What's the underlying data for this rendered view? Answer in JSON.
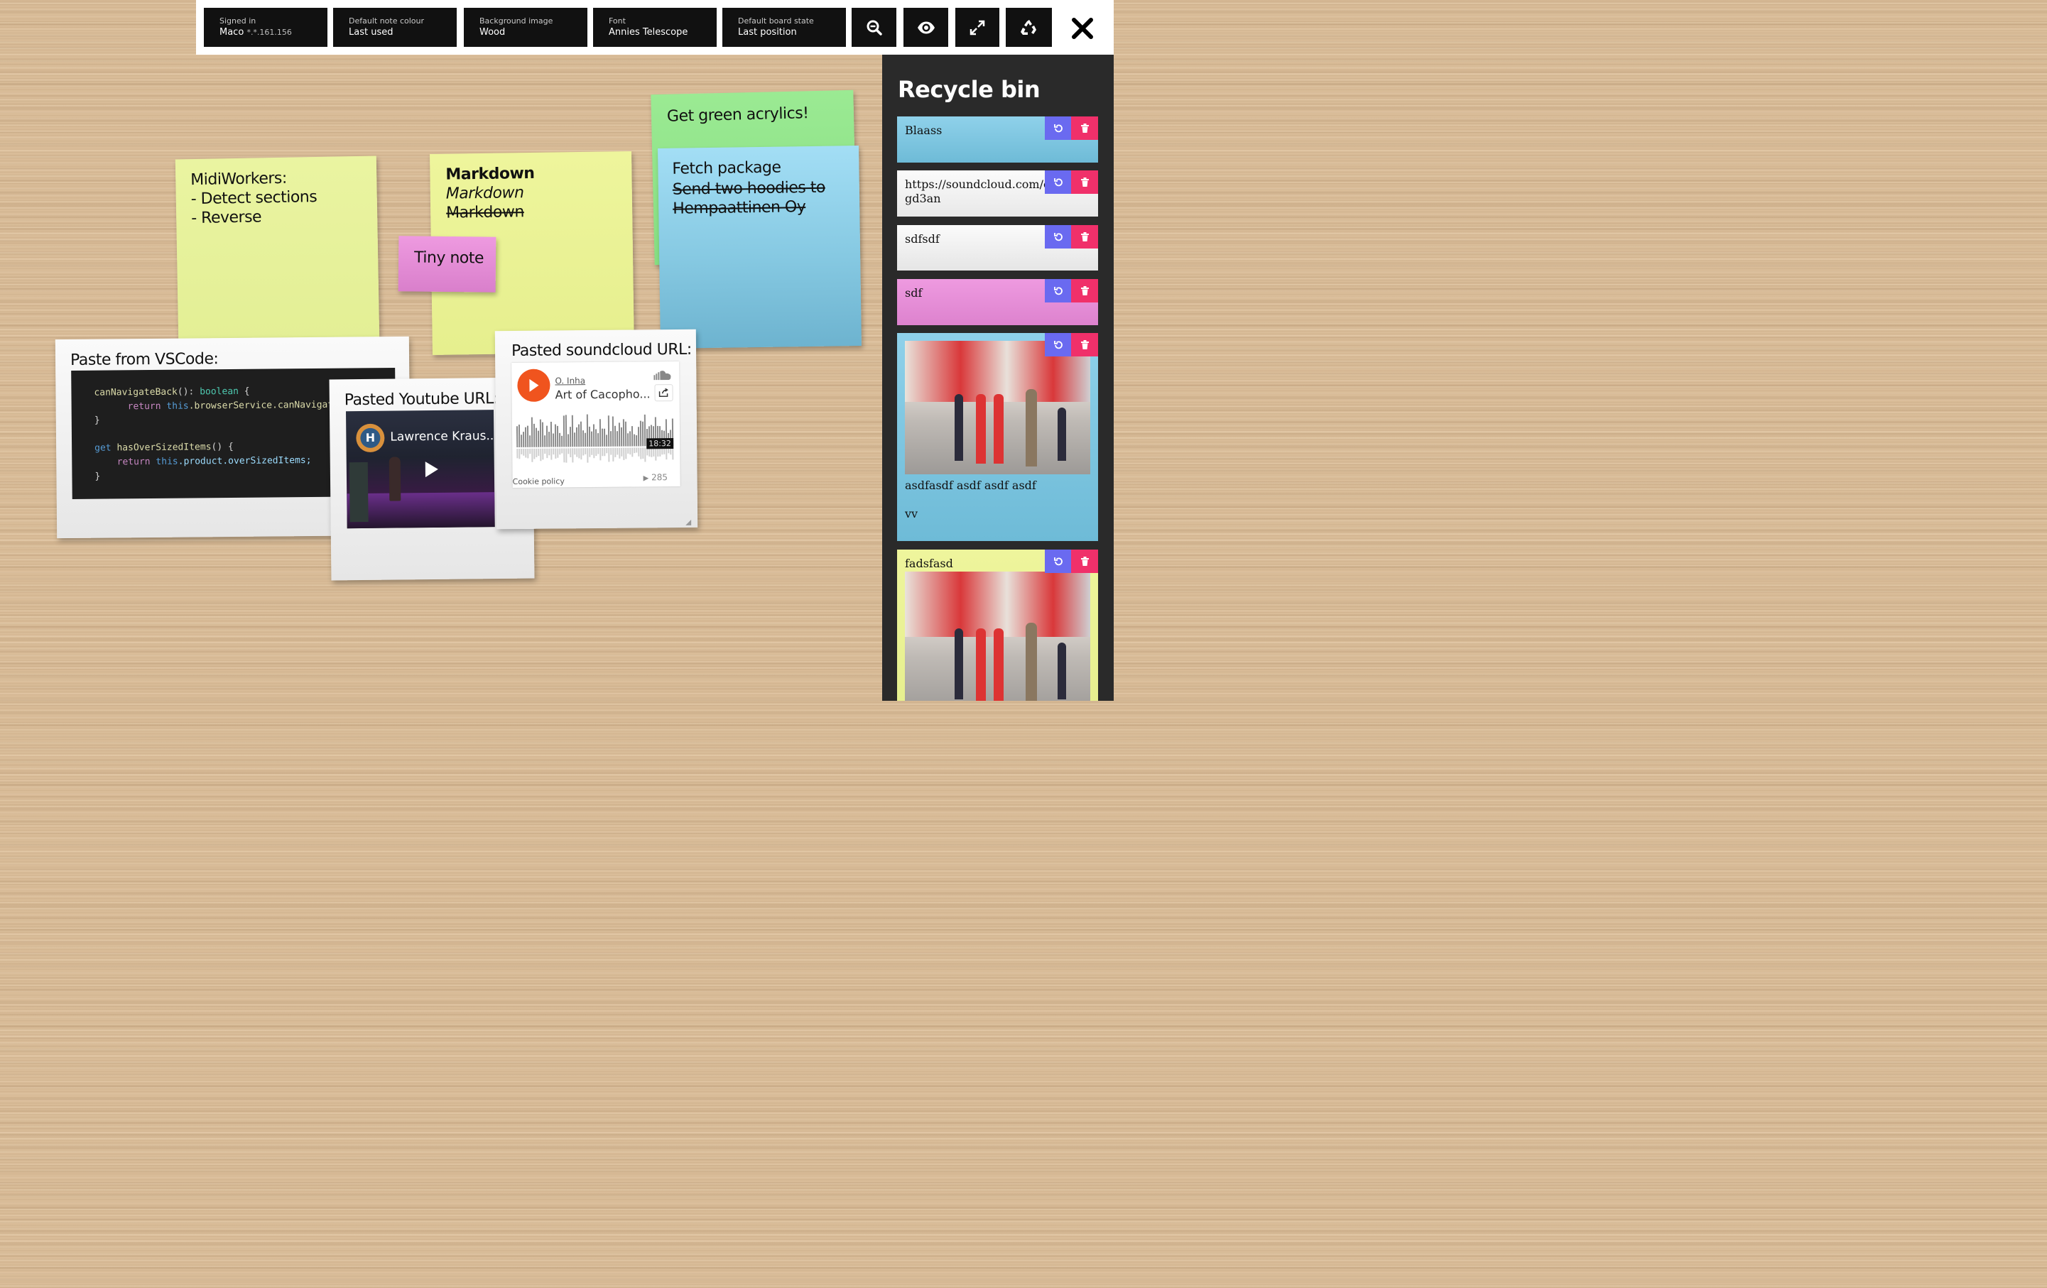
{
  "toolbar": {
    "signed_in": {
      "label": "Signed in",
      "value": "Maco",
      "ip": "*.*.161.156"
    },
    "note_colour": {
      "label": "Default note colour",
      "value": "Last used"
    },
    "background": {
      "label": "Background image",
      "value": "Wood"
    },
    "font": {
      "label": "Font",
      "value": "Annies Telescope"
    },
    "board_state": {
      "label": "Default board state",
      "value": "Last position"
    },
    "icons": [
      "zoom-out-icon",
      "eye-icon",
      "fullscreen-icon",
      "recycle-icon",
      "close-icon"
    ]
  },
  "notes": {
    "midi": {
      "lines": [
        "MidiWorkers:",
        "- Detect sections",
        "- Reverse"
      ],
      "color": "#eaf4a1"
    },
    "markdown": {
      "lines": [
        "Markdown",
        "Markdown",
        "Markdown"
      ],
      "color": "#eef59c"
    },
    "tiny": {
      "text": "Tiny note",
      "color": "#e58ad6"
    },
    "green": {
      "text": "Get green acrylics!",
      "color": "#8fe38a"
    },
    "fetch": {
      "title": "Fetch package",
      "struck": [
        "Send two hoodies to",
        "Hempaattinen Oy"
      ],
      "color": "#9bdaf0"
    }
  },
  "cards": {
    "vscode": {
      "title": "Paste from VSCode:",
      "code": {
        "l1_fn": "canNavigateBack",
        "l1_mid": "(): ",
        "l1_type": "boolean",
        "l1_end": " {",
        "l2_kw": "return ",
        "l2_this": "this",
        "l2_rest": ".browserService.canNavigate",
        "l3": "}",
        "l5_kw": "get ",
        "l5_fn": "hasOverSizedItems",
        "l5_end": "() {",
        "l6_kw": "return ",
        "l6_this": "this",
        "l6_rest": ".product.overSizedItems;",
        "l7": "}"
      }
    },
    "youtube": {
      "title": "Pasted Youtube URL:",
      "video_title": "Lawrence Kraus..."
    },
    "soundcloud": {
      "title": "Pasted soundcloud URL:",
      "artist": "O. Inha",
      "track": "Art of Cacopho...",
      "duration": "18:32",
      "cookie": "Cookie policy",
      "plays": "285"
    }
  },
  "recycle_bin": {
    "title": "Recycle bin",
    "items": [
      {
        "text": "Blaass",
        "color": "#7ec8e3"
      },
      {
        "text": "https://soundcloud.com/essil",
        "text2": "gd3an",
        "color": "#f0f0f0"
      },
      {
        "text": "sdfsdf",
        "color": "#f0f0f0"
      },
      {
        "text": "sdf",
        "color": "#e58ad6"
      },
      {
        "text": "asdfasdf asdf asdf asdf",
        "text2": "vv",
        "color": "#7ec8e3"
      },
      {
        "text": "fadsfasd",
        "color": "#eef59c"
      }
    ]
  }
}
